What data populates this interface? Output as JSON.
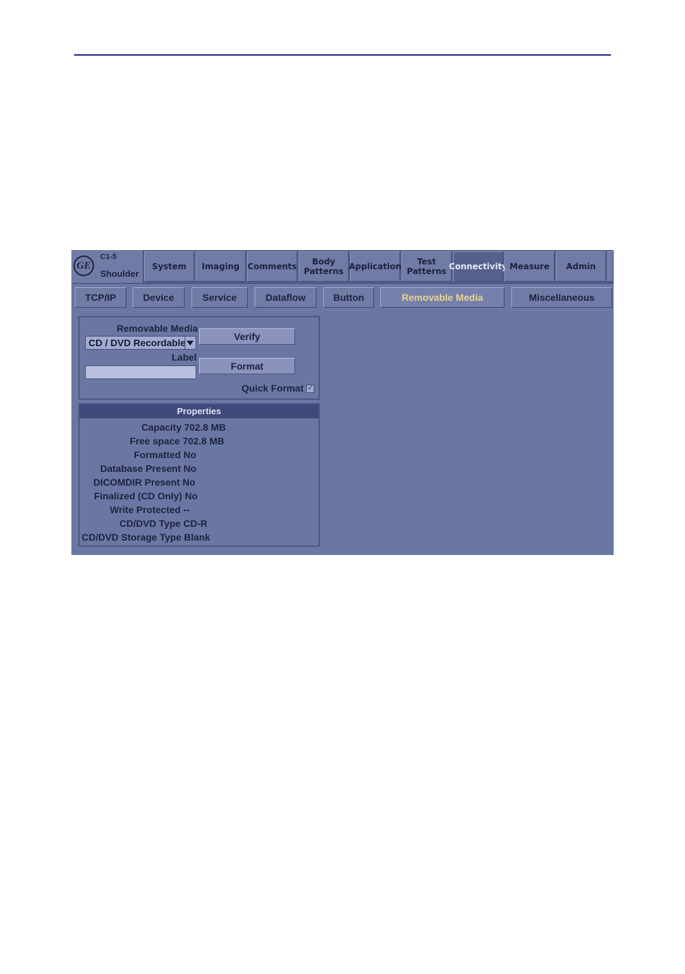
{
  "header": {
    "probe": "C1-5",
    "preset": "Shoulder",
    "logo_text": "GE"
  },
  "top_tabs": [
    {
      "label": "System",
      "active": false
    },
    {
      "label": "Imaging",
      "active": false
    },
    {
      "label": "Comments",
      "active": false
    },
    {
      "label": "Body\nPatterns",
      "active": false
    },
    {
      "label": "Application",
      "active": false
    },
    {
      "label": "Test\nPatterns",
      "active": false
    },
    {
      "label": "Connectivity",
      "active": true
    },
    {
      "label": "Measure",
      "active": false
    },
    {
      "label": "Admin",
      "active": false
    }
  ],
  "sub_tabs": [
    {
      "label": "TCP/IP",
      "active": false
    },
    {
      "label": "Device",
      "active": false
    },
    {
      "label": "Service",
      "active": false
    },
    {
      "label": "Dataflow",
      "active": false
    },
    {
      "label": "Button",
      "active": false
    },
    {
      "label": "Removable Media",
      "active": true
    },
    {
      "label": "Miscellaneous",
      "active": false
    }
  ],
  "media": {
    "section_label": "Removable Media",
    "selected_media": "CD / DVD Recordable",
    "label_caption": "Label",
    "label_value": "",
    "verify_button": "Verify",
    "format_button": "Format",
    "quick_format_label": "Quick Format",
    "quick_format_checked": true,
    "check_glyph": "✓"
  },
  "properties": {
    "title": "Properties",
    "rows": [
      {
        "key": "Capacity",
        "value": "702.8 MB"
      },
      {
        "key": "Free space",
        "value": "702.8 MB"
      },
      {
        "key": "Formatted",
        "value": "No"
      },
      {
        "key": "Database Present",
        "value": "No"
      },
      {
        "key": "DICOMDIR Present",
        "value": "No"
      },
      {
        "key": "Finalized (CD Only)",
        "value": "No"
      },
      {
        "key": "Write Protected",
        "value": "--"
      },
      {
        "key": "CD/DVD Type",
        "value": "CD-R"
      },
      {
        "key": "CD/DVD Storage Type",
        "value": "Blank"
      }
    ]
  },
  "colors": {
    "background": "#6b77a3",
    "active_subtab_text": "#e8d58a",
    "rule": "#1d1d8f"
  }
}
